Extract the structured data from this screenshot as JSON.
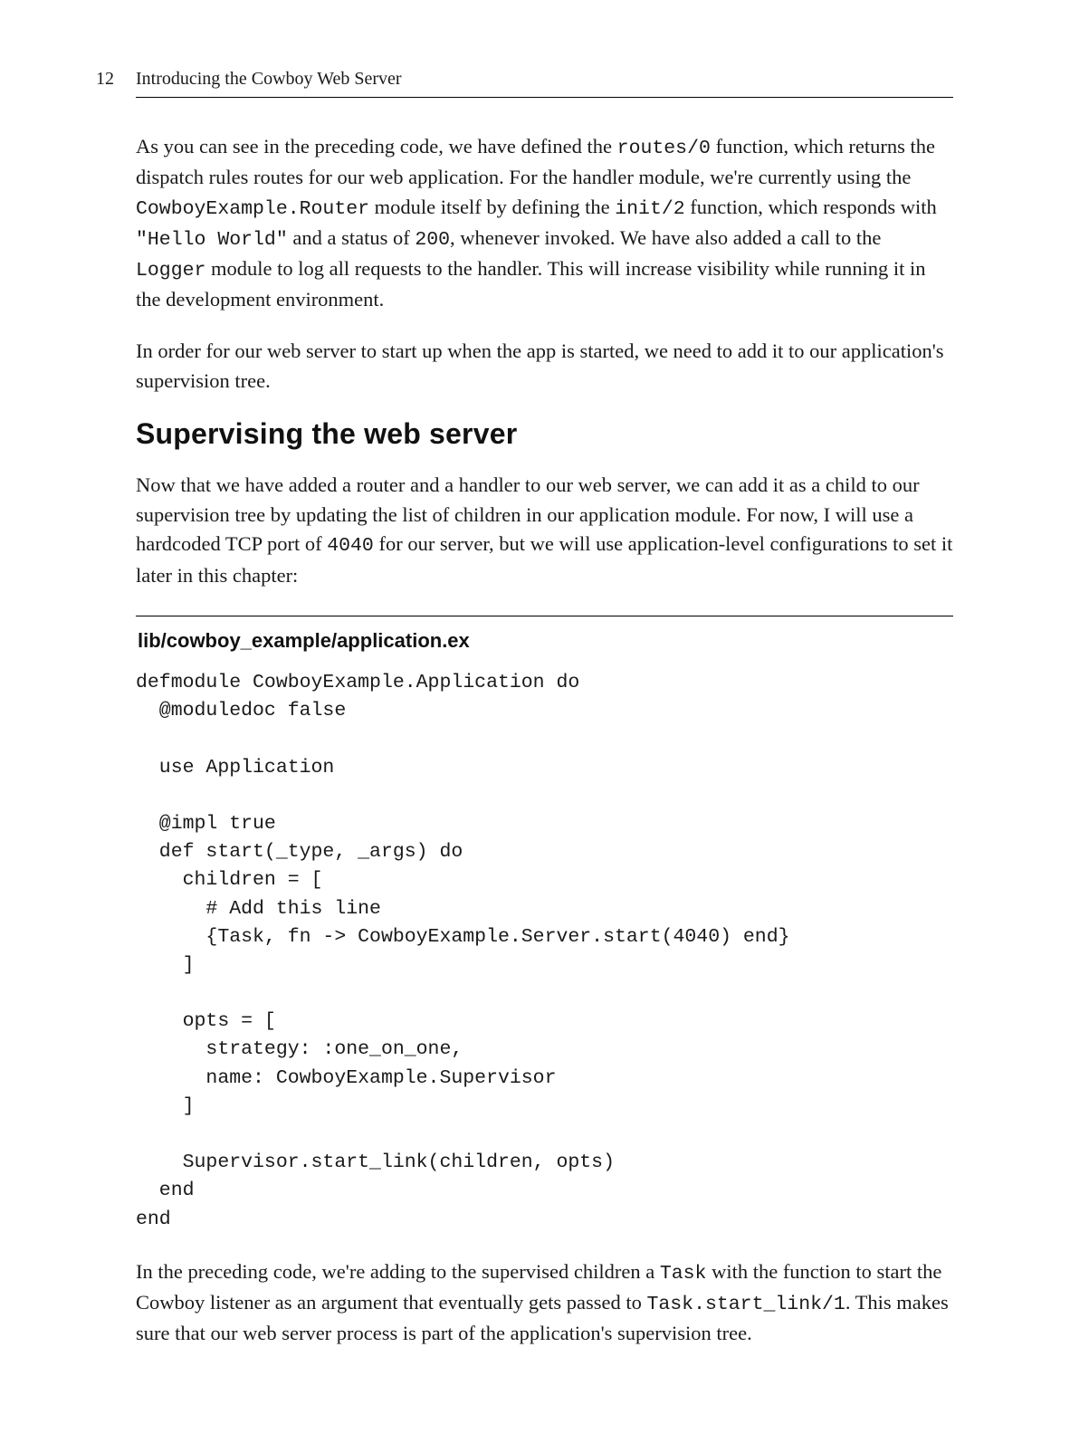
{
  "header": {
    "page_number": "12",
    "running_title": "Introducing the Cowboy Web Server"
  },
  "para1": {
    "t1": "As you can see in the preceding code, we have defined the ",
    "c1": "routes/0",
    "t2": " function, which returns the dispatch rules routes for our web application. For the handler module, we're currently using the ",
    "c2": "CowboyExample.Router",
    "t3": " module itself by defining the ",
    "c3": "init/2",
    "t4": " function, which responds with ",
    "c4": "\"Hello World\"",
    "t5": " and a status of ",
    "c5": "200",
    "t6": ", whenever invoked. We have also added a call to the ",
    "c6": "Logger",
    "t7": " module to log all requests to the handler. This will increase visibility while running it in the development environment."
  },
  "para2": "In order for our web server to start up when the app is started, we need to add it to our application's supervision tree.",
  "section_heading": "Supervising the web server",
  "para3": {
    "t1": "Now that we have added a router and a handler to our web server, we can add it as a child to our supervision tree by updating the list of children in our application module. For now, I will use a hardcoded TCP port of ",
    "c1": "4040",
    "t2": " for our server, but we will use application-level configurations to set it later in this chapter:"
  },
  "code_label": "lib/cowboy_example/application.ex",
  "code_block": "defmodule CowboyExample.Application do\n  @moduledoc false\n\n  use Application\n\n  @impl true\n  def start(_type, _args) do\n    children = [\n      # Add this line\n      {Task, fn -> CowboyExample.Server.start(4040) end}\n    ]\n\n    opts = [\n      strategy: :one_on_one,\n      name: CowboyExample.Supervisor\n    ]\n\n    Supervisor.start_link(children, opts)\n  end\nend",
  "para4": {
    "t1": "In the preceding code, we're adding to the supervised children a ",
    "c1": "Task",
    "t2": " with the function to start the Cowboy listener as an argument that eventually gets passed to ",
    "c2": "Task.start_link/1",
    "t3": ". This makes sure that our web server process is part of the application's supervision tree."
  }
}
